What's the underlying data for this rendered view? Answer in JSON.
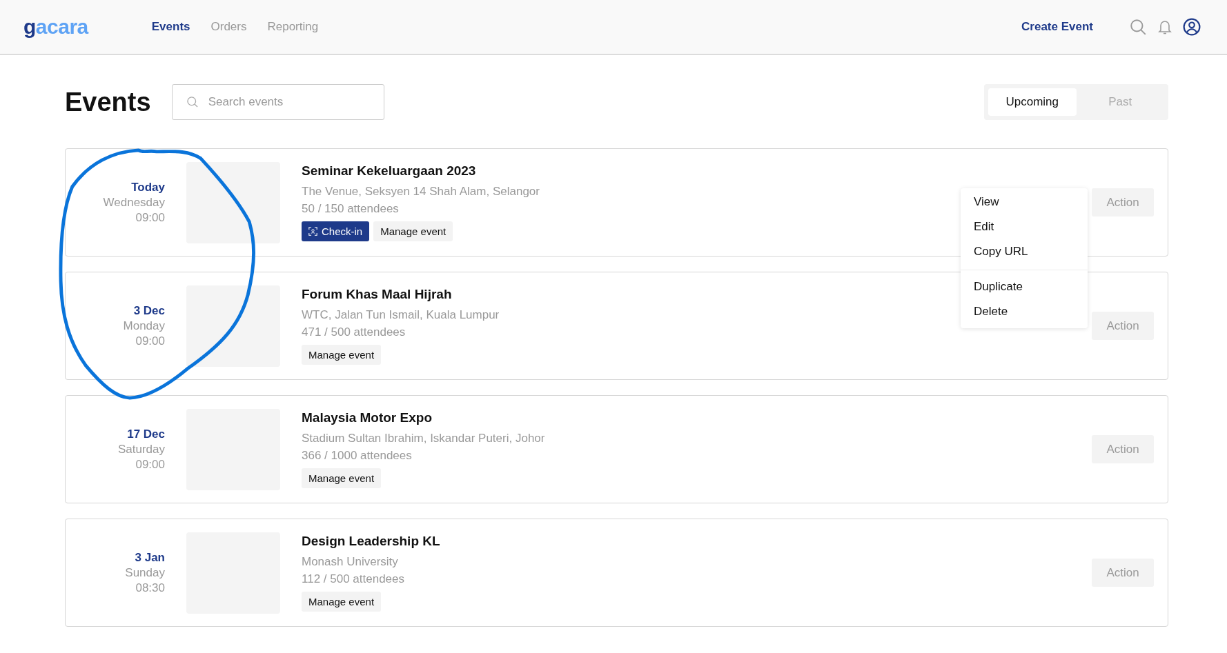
{
  "header": {
    "logo": {
      "lead": "g",
      "rest": "acara"
    },
    "nav": [
      {
        "label": "Events",
        "selected": true
      },
      {
        "label": "Orders",
        "selected": false
      },
      {
        "label": "Reporting",
        "selected": false
      }
    ],
    "create_button": "Create Event"
  },
  "page": {
    "title": "Events",
    "search": {
      "placeholder": "Search events"
    },
    "filter": [
      {
        "label": "Upcoming",
        "selected": true
      },
      {
        "label": "Past",
        "selected": false
      }
    ]
  },
  "events": [
    {
      "date": "Today",
      "weekday": "Wednesday",
      "time": "09:00",
      "title": "Seminar Kekeluargaan 2023",
      "venue": "The Venue, Seksyen 14 Shah Alam, Selangor",
      "attendees": "50 / 150 attendees",
      "buttons": [
        {
          "kind": "checkin",
          "label": "Check-in"
        },
        {
          "kind": "manage",
          "label": "Manage event"
        }
      ],
      "action": "Action",
      "menu_open": true
    },
    {
      "date": "3 Dec",
      "weekday": "Monday",
      "time": "09:00",
      "title": "Forum Khas Maal Hijrah",
      "venue": "WTC, Jalan Tun Ismail, Kuala Lumpur",
      "attendees": "471 / 500 attendees",
      "buttons": [
        {
          "kind": "manage",
          "label": "Manage event"
        }
      ],
      "action": "Action",
      "menu_open": false
    },
    {
      "date": "17 Dec",
      "weekday": "Saturday",
      "time": "09:00",
      "title": "Malaysia Motor Expo",
      "venue": "Stadium Sultan Ibrahim, Iskandar Puteri, Johor",
      "attendees": "366 / 1000 attendees",
      "buttons": [
        {
          "kind": "manage",
          "label": "Manage event"
        }
      ],
      "action": "Action",
      "menu_open": false
    },
    {
      "date": "3 Jan",
      "weekday": "Sunday",
      "time": "08:30",
      "title": "Design Leadership KL",
      "venue": "Monash University",
      "attendees": "112 / 500 attendees",
      "buttons": [
        {
          "kind": "manage",
          "label": "Manage event"
        }
      ],
      "action": "Action",
      "menu_open": false
    }
  ],
  "action_menu": {
    "groups": [
      [
        "View",
        "Edit",
        "Copy URL"
      ],
      [
        "Duplicate",
        "Delete"
      ]
    ]
  },
  "annotation": {
    "kind": "circle"
  }
}
